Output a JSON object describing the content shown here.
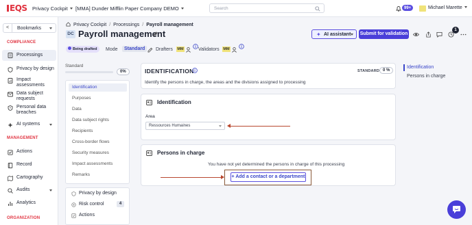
{
  "topbar": {
    "logo": "EQS",
    "workspace": "Privacy Cockpit",
    "company": "[MMA] Dunder Mifflin Paper Company DEMO",
    "search_placeholder": "Search",
    "notifications_count": "99+",
    "user_name": "Michael Marette"
  },
  "leftnav": {
    "bookmarks_label": "Bookmarks",
    "collapse_glyph": "<",
    "sections": {
      "compliance": "COMPLIANCE",
      "management": "MANAGEMENT",
      "organization": "ORGANIZATION"
    },
    "compliance_items": [
      "Processings",
      "Privacy by design",
      "Impact assessments",
      "Data subject requests",
      "Personal data breaches",
      "AI systems"
    ],
    "management_items": [
      "Actions",
      "Record",
      "Cartography",
      "Audits",
      "Analytics"
    ]
  },
  "header": {
    "breadcrumb": [
      "Privacy Cockpit",
      "Processings",
      "Payroll management"
    ],
    "badge": "DC",
    "title": "Payroll management",
    "ai_button": "AI assistant",
    "submit_button": "Submit for validation",
    "notification_badge": "1",
    "status": "Being drafted",
    "mode_label": "Mode",
    "mode_value": "Standard",
    "drafters_label": "Drafters",
    "validators_label": "Validators",
    "drafter_initials": "MM",
    "validator_initials": "MM"
  },
  "completion": {
    "label": "Standard",
    "percent": "0%",
    "progress_fraction": 0
  },
  "sections_nav": [
    "Identification",
    "Purposes",
    "Data",
    "Data subject rights",
    "Recipients",
    "Cross-border flows",
    "Security measures",
    "Impact assessments",
    "Remarks"
  ],
  "bottom_nav": {
    "items": [
      "Privacy by design",
      "Risk control",
      "Actions"
    ],
    "risk_count": "4"
  },
  "identification": {
    "title": "IDENTIFICATION",
    "description": "Identify the persons in charge, the areas and the divisions assigned to processing",
    "standard_label": "STANDARD",
    "percent": "0 %",
    "sub_title": "Identification",
    "area_label": "Area",
    "area_value": "Ressources Humaines"
  },
  "persons": {
    "title": "Persons in charge",
    "empty_message": "You have not yet determined the persons in charge of this processing",
    "add_button": "+  Add a contact or a department"
  },
  "toc": [
    "Identification",
    "Persons in charge"
  ],
  "colors": {
    "accent": "#4a3fd9",
    "brand_red": "#e0323f",
    "annotation": "#b8472e"
  }
}
